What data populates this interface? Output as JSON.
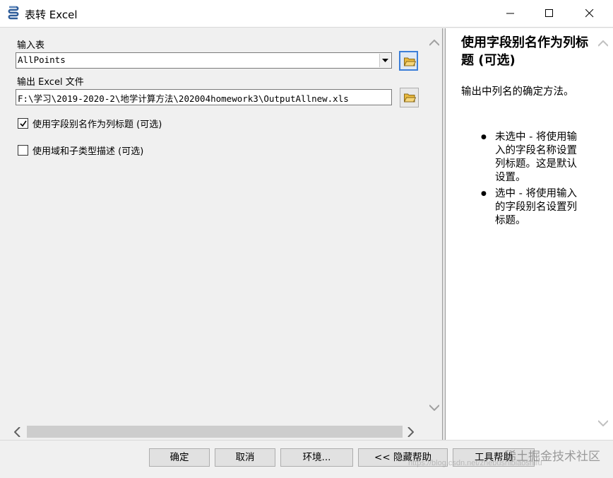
{
  "window": {
    "title": "表转 Excel"
  },
  "form": {
    "input_table_label": "输入表",
    "input_table_value": "AllPoints",
    "output_file_label": "输出 Excel 文件",
    "output_file_value": "F:\\学习\\2019-2020-2\\地学计算方法\\202004homework3\\OutputAllnew.xls",
    "checkbox_alias_label": "使用字段别名作为列标题 (可选)",
    "checkbox_alias_checked": true,
    "checkbox_domain_label": "使用域和子类型描述 (可选)",
    "checkbox_domain_checked": false
  },
  "help": {
    "title": "使用字段别名作为列标题 (可选)",
    "description": "输出中列名的确定方法。",
    "items": [
      "未选中 - 将使用输入的字段名称设置列标题。这是默认设置。",
      "选中 - 将使用输入的字段别名设置列标题。"
    ]
  },
  "buttons": {
    "ok": "确定",
    "cancel": "取消",
    "environments": "环境...",
    "hide_help": "<< 隐藏帮助",
    "tool_help": "工具帮助"
  },
  "watermark": {
    "text": "稀土掘金技术社区",
    "url": "https://blog.csdn.net/zhebushibiaoshifu"
  },
  "colors": {
    "focus_border": "#3c7fd8",
    "folder_yellow": "#e8b83c"
  },
  "icons": {
    "app": "arctoolbox-script-icon",
    "folder": "open-folder-icon"
  }
}
